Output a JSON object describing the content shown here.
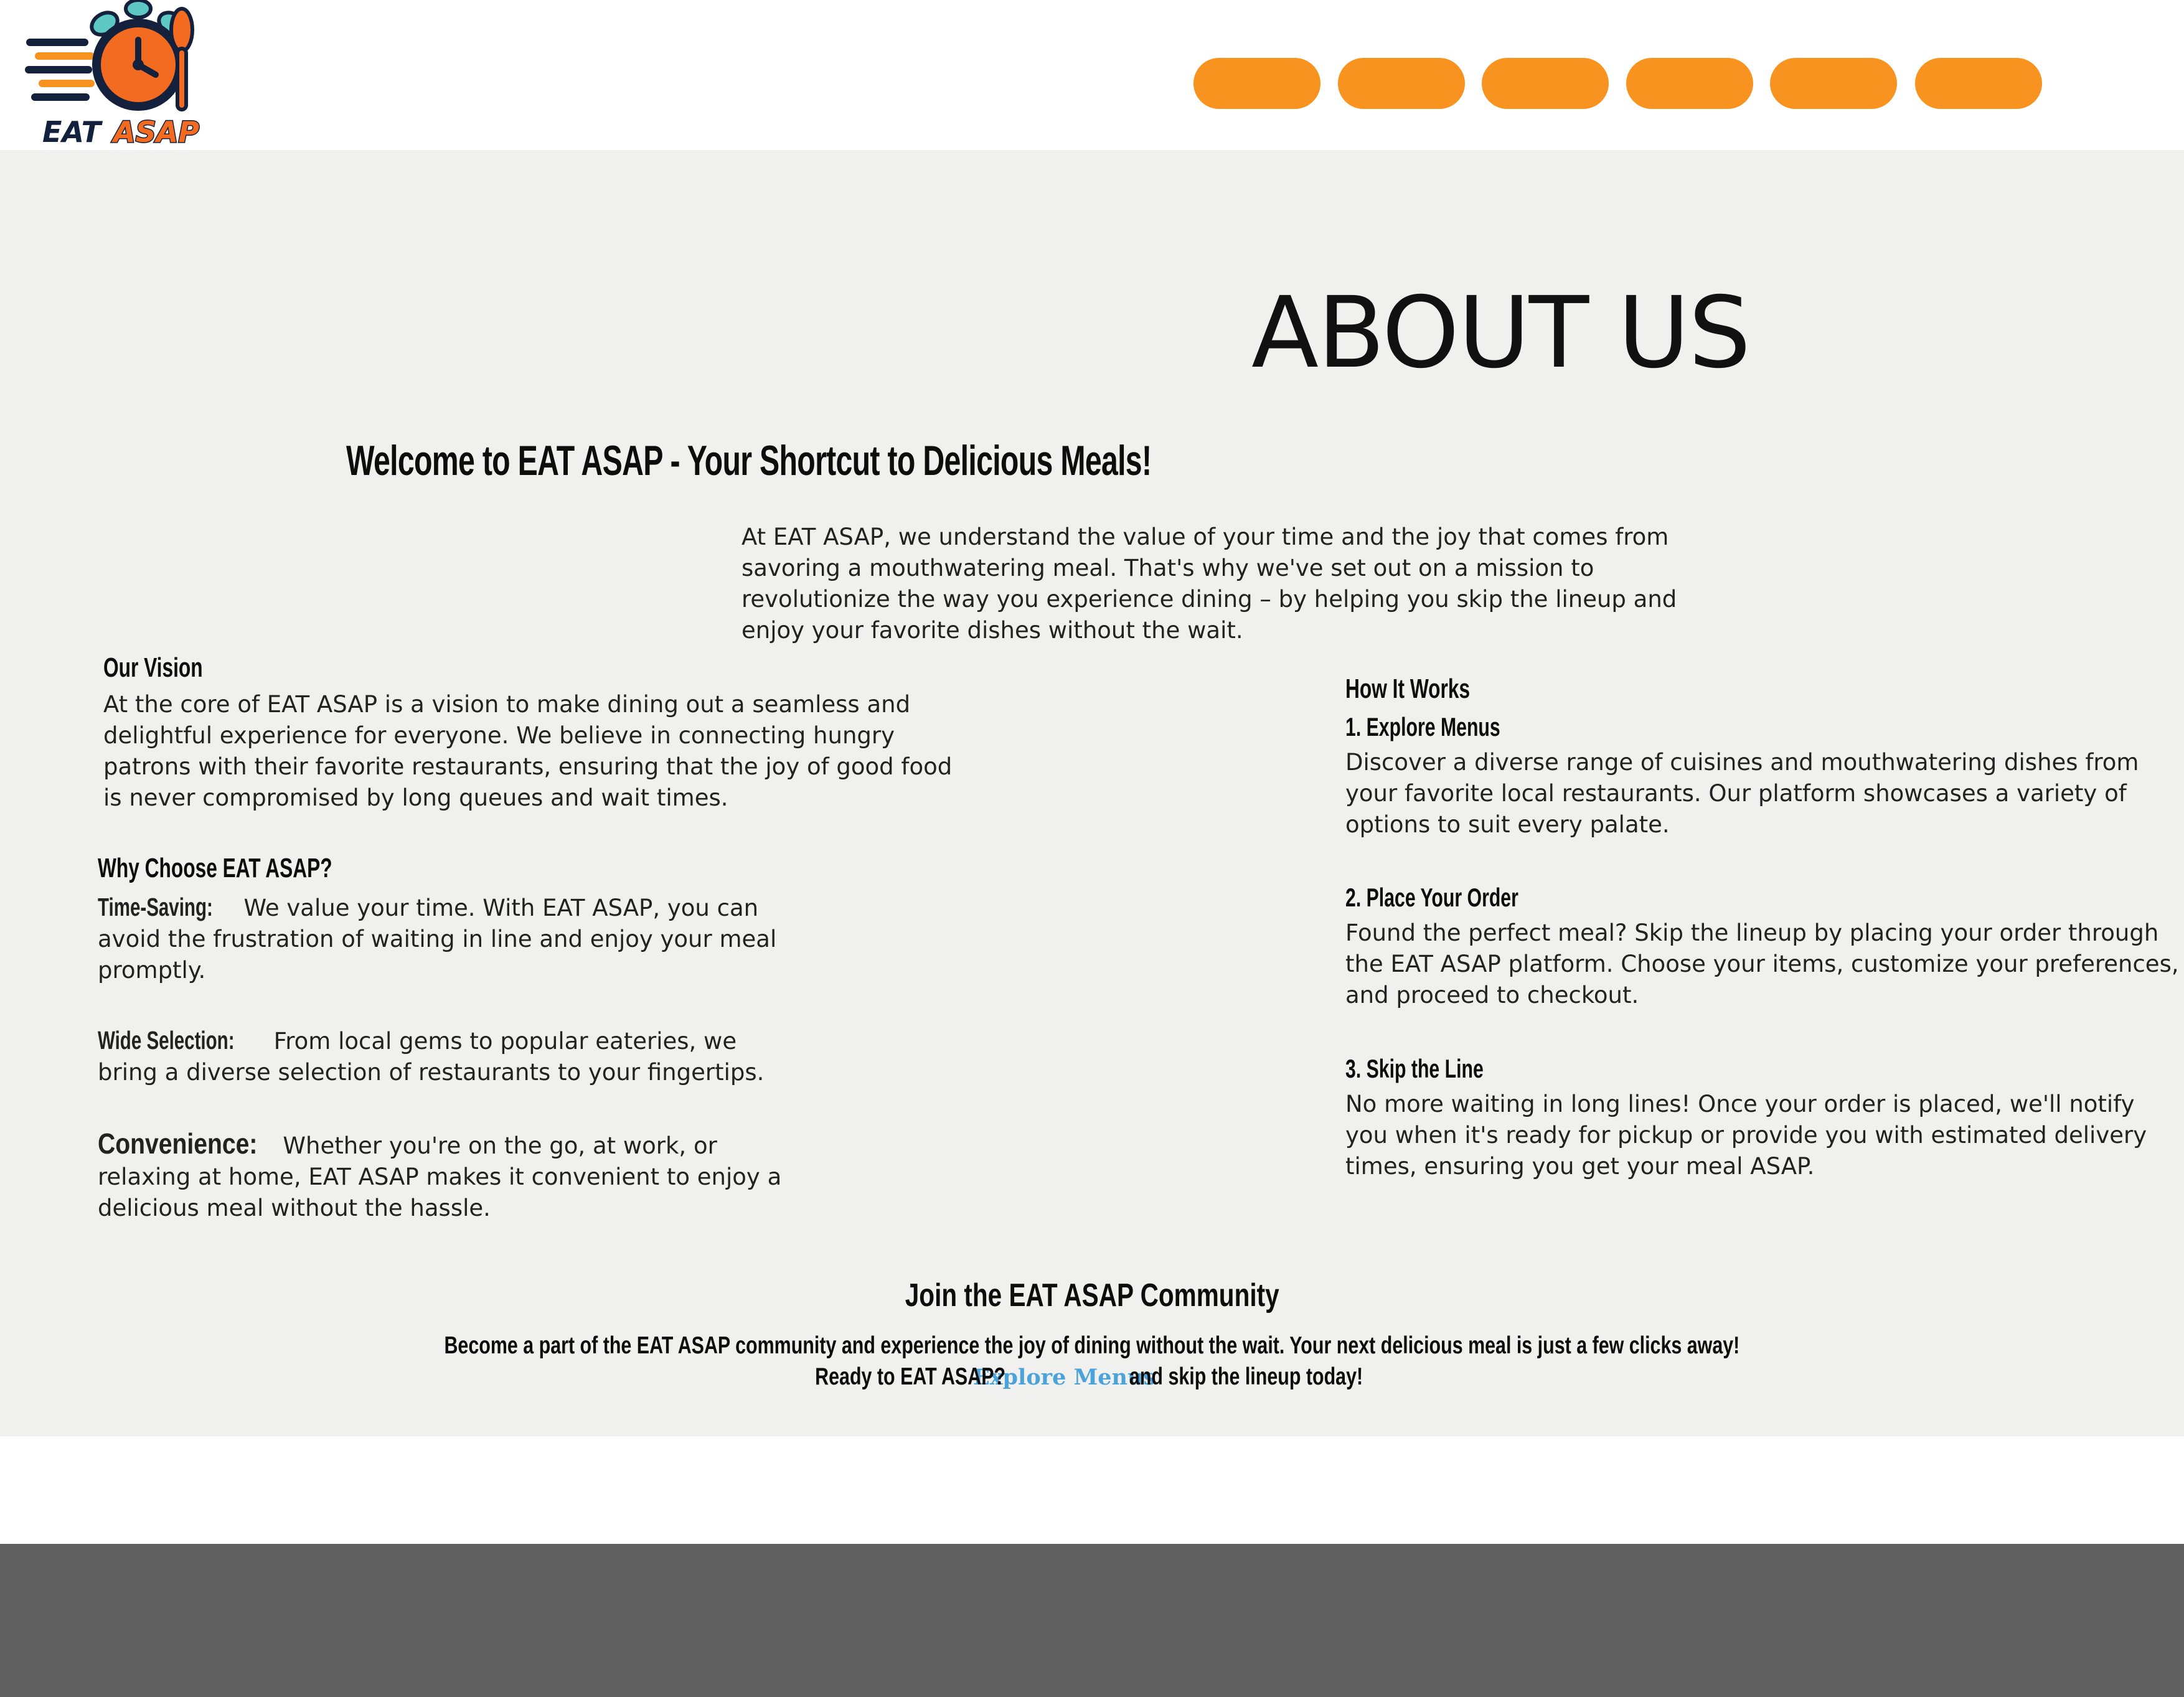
{
  "header": {
    "logo_text": "EAT ASAP",
    "nav_buttons": [
      "",
      "",
      "",
      "",
      "",
      ""
    ],
    "brand_colors": {
      "orange": "#f7931e",
      "navy": "#14213d",
      "teal": "#5ec8c4"
    }
  },
  "about": {
    "title": "ABOUT US",
    "welcome_heading": "Welcome to EAT ASAP - Your Shortcut to Delicious Meals!",
    "intro": "At EAT ASAP, we understand the value of your time and the joy that comes from savoring a mouthwatering meal. That's why we've set out on a mission to revolutionize the way you experience dining – by helping you skip the lineup and enjoy your favorite dishes without the wait."
  },
  "vision": {
    "heading": "Our Vision",
    "text": "At the core of EAT ASAP is a vision to make dining out a seamless and delightful experience for everyone. We believe in connecting hungry patrons with their favorite restaurants, ensuring that the joy of good food is never compromised by long queues and wait times."
  },
  "why": {
    "heading": "Why Choose EAT ASAP?",
    "items": [
      {
        "label": "Time-Saving:",
        "text": "We value your time. With EAT ASAP, you can avoid the frustration of waiting in line and enjoy your meal promptly."
      },
      {
        "label": "Wide Selection:",
        "text": "From local gems to popular eateries, we bring a diverse selection of restaurants to your fingertips."
      },
      {
        "label": "Convenience:",
        "text": "Whether you're on the go, at work, or relaxing at home, EAT ASAP makes it convenient to enjoy a delicious meal without the hassle."
      }
    ]
  },
  "how": {
    "heading": "How It Works",
    "steps": [
      {
        "title": "1. Explore Menus",
        "text": "Discover a diverse range of cuisines and mouthwatering dishes from your favorite local restaurants. Our platform showcases a variety of options to suit every palate."
      },
      {
        "title": "2. Place Your Order",
        "text": "Found the perfect meal? Skip the lineup by placing your order through the EAT ASAP platform. Choose your items, customize your preferences, and proceed to checkout."
      },
      {
        "title": "3. Skip the Line",
        "text": "No more waiting in long lines! Once your order is placed, we'll notify you when it's ready for pickup or provide you with estimated delivery times, ensuring you get your meal ASAP."
      }
    ]
  },
  "community": {
    "heading": "Join the EAT ASAP Community",
    "line1": "Become a part of the EAT ASAP community and experience the joy of dining without the wait. Your next delicious meal is just a few clicks away!",
    "line2_before": "Ready to EAT ASAP?",
    "link_text": "Explore Menus",
    "line2_after": "and skip the lineup today!"
  }
}
